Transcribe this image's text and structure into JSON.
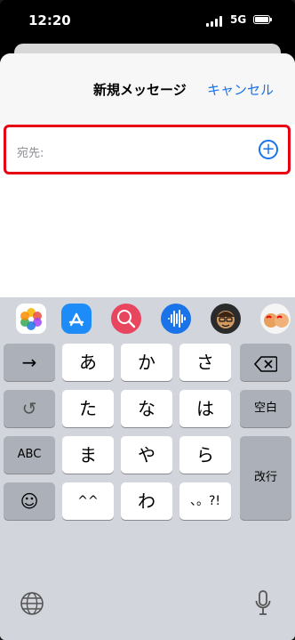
{
  "status": {
    "time": "12:20",
    "network": "5G"
  },
  "header": {
    "title": "新規メッセージ",
    "cancel_label": "キャンセル"
  },
  "recipient": {
    "label": "宛先:"
  },
  "compose": {
    "placeholder": ""
  },
  "keyboard": {
    "rows": [
      [
        "→",
        "あ",
        "か",
        "さ",
        "⌫"
      ],
      [
        "↺",
        "た",
        "な",
        "は",
        "空白"
      ],
      [
        "ABC",
        "ま",
        "や",
        "ら",
        "改行"
      ],
      [
        "☺",
        "^^",
        "わ",
        "、。?!"
      ]
    ],
    "keys": {
      "arrow": "→",
      "a": "あ",
      "ka": "か",
      "sa": "さ",
      "undo": "↺",
      "ta": "た",
      "na": "な",
      "ha": "は",
      "space": "空白",
      "abc": "ABC",
      "ma": "ま",
      "ya": "や",
      "ra": "ら",
      "return": "改行",
      "emoji": "☺",
      "kaomoji": "^^",
      "wa": "わ",
      "punct": "、。?!"
    }
  },
  "colors": {
    "accent": "#1a73e8",
    "highlight": "#e60012",
    "keyboard_bg": "#d2d5db"
  },
  "icons": {
    "app_strip": [
      "photos-icon",
      "app-store-icon",
      "search-images-icon",
      "audio-message-icon",
      "memoji-icon",
      "memoji-stickers-icon"
    ],
    "compose": [
      "camera-icon",
      "apps-icon",
      "microphone-icon"
    ],
    "bottom": [
      "globe-icon",
      "dictation-icon"
    ]
  }
}
